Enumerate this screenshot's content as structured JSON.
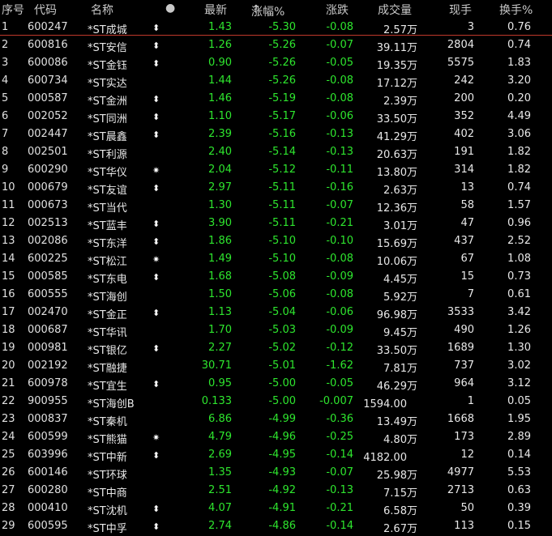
{
  "columns": {
    "no": "序号",
    "code": "代码",
    "name": "名称",
    "dot": "●",
    "last": "最新",
    "chgpct": "涨幅%",
    "sort_icon": "↑",
    "chg": "涨跌",
    "vol": "成交量",
    "hand": "现手",
    "turn": "换手%"
  },
  "unit_wan": "万",
  "rows": [
    {
      "no": "1",
      "code": "600247",
      "name": "*ST成城",
      "flag": "⬍",
      "last": "1.43",
      "chgpct": "-5.30",
      "chg": "-0.08",
      "vol": "2.57",
      "wan": true,
      "hand": "3",
      "turn": "0.76"
    },
    {
      "no": "2",
      "code": "600816",
      "name": "*ST安信",
      "flag": "⬍",
      "last": "1.26",
      "chgpct": "-5.26",
      "chg": "-0.07",
      "vol": "39.11",
      "wan": true,
      "hand": "2804",
      "turn": "0.74"
    },
    {
      "no": "3",
      "code": "600086",
      "name": "*ST金钰",
      "flag": "⬍",
      "last": "0.90",
      "chgpct": "-5.26",
      "chg": "-0.05",
      "vol": "19.35",
      "wan": true,
      "hand": "5575",
      "turn": "1.83"
    },
    {
      "no": "4",
      "code": "600734",
      "name": "*ST实达",
      "flag": "",
      "last": "1.44",
      "chgpct": "-5.26",
      "chg": "-0.08",
      "vol": "17.12",
      "wan": true,
      "hand": "242",
      "turn": "3.20"
    },
    {
      "no": "5",
      "code": "000587",
      "name": "*ST金洲",
      "flag": "⬍",
      "last": "1.46",
      "chgpct": "-5.19",
      "chg": "-0.08",
      "vol": "2.39",
      "wan": true,
      "hand": "200",
      "turn": "0.20"
    },
    {
      "no": "6",
      "code": "002052",
      "name": "*ST同洲",
      "flag": "⬍",
      "last": "1.10",
      "chgpct": "-5.17",
      "chg": "-0.06",
      "vol": "33.50",
      "wan": true,
      "hand": "352",
      "turn": "4.49"
    },
    {
      "no": "7",
      "code": "002447",
      "name": "*ST晨鑫",
      "flag": "⬍",
      "last": "2.39",
      "chgpct": "-5.16",
      "chg": "-0.13",
      "vol": "41.29",
      "wan": true,
      "hand": "402",
      "turn": "3.06"
    },
    {
      "no": "8",
      "code": "002501",
      "name": "*ST利源",
      "flag": "",
      "last": "2.40",
      "chgpct": "-5.14",
      "chg": "-0.13",
      "vol": "20.63",
      "wan": true,
      "hand": "191",
      "turn": "1.82"
    },
    {
      "no": "9",
      "code": "600290",
      "name": "*ST华仪",
      "flag": "✷",
      "last": "2.04",
      "chgpct": "-5.12",
      "chg": "-0.11",
      "vol": "13.80",
      "wan": true,
      "hand": "314",
      "turn": "1.82"
    },
    {
      "no": "10",
      "code": "000679",
      "name": "*ST友谊",
      "flag": "⬍",
      "last": "2.97",
      "chgpct": "-5.11",
      "chg": "-0.16",
      "vol": "2.63",
      "wan": true,
      "hand": "13",
      "turn": "0.74"
    },
    {
      "no": "11",
      "code": "000673",
      "name": "*ST当代",
      "flag": "",
      "last": "1.30",
      "chgpct": "-5.11",
      "chg": "-0.07",
      "vol": "12.36",
      "wan": true,
      "hand": "58",
      "turn": "1.57"
    },
    {
      "no": "12",
      "code": "002513",
      "name": "*ST蓝丰",
      "flag": "⬍",
      "last": "3.90",
      "chgpct": "-5.11",
      "chg": "-0.21",
      "vol": "3.01",
      "wan": true,
      "hand": "47",
      "turn": "0.96"
    },
    {
      "no": "13",
      "code": "002086",
      "name": "*ST东洋",
      "flag": "⬍",
      "last": "1.86",
      "chgpct": "-5.10",
      "chg": "-0.10",
      "vol": "15.69",
      "wan": true,
      "hand": "437",
      "turn": "2.52"
    },
    {
      "no": "14",
      "code": "600225",
      "name": "*ST松江",
      "flag": "✷",
      "last": "1.49",
      "chgpct": "-5.10",
      "chg": "-0.08",
      "vol": "10.06",
      "wan": true,
      "hand": "67",
      "turn": "1.08"
    },
    {
      "no": "15",
      "code": "000585",
      "name": "*ST东电",
      "flag": "⬍",
      "last": "1.68",
      "chgpct": "-5.08",
      "chg": "-0.09",
      "vol": "4.45",
      "wan": true,
      "hand": "15",
      "turn": "0.73"
    },
    {
      "no": "16",
      "code": "600555",
      "name": "*ST海创",
      "flag": "",
      "last": "1.50",
      "chgpct": "-5.06",
      "chg": "-0.08",
      "vol": "5.92",
      "wan": true,
      "hand": "7",
      "turn": "0.61"
    },
    {
      "no": "17",
      "code": "002470",
      "name": "*ST金正",
      "flag": "⬍",
      "last": "1.13",
      "chgpct": "-5.04",
      "chg": "-0.06",
      "vol": "96.98",
      "wan": true,
      "hand": "3533",
      "turn": "3.42"
    },
    {
      "no": "18",
      "code": "000687",
      "name": "*ST华讯",
      "flag": "",
      "last": "1.70",
      "chgpct": "-5.03",
      "chg": "-0.09",
      "vol": "9.45",
      "wan": true,
      "hand": "490",
      "turn": "1.26"
    },
    {
      "no": "19",
      "code": "000981",
      "name": "*ST银亿",
      "flag": "⬍",
      "last": "2.27",
      "chgpct": "-5.02",
      "chg": "-0.12",
      "vol": "33.50",
      "wan": true,
      "hand": "1689",
      "turn": "1.30"
    },
    {
      "no": "20",
      "code": "002192",
      "name": "*ST融捷",
      "flag": "",
      "last": "30.71",
      "chgpct": "-5.01",
      "chg": "-1.62",
      "vol": "7.81",
      "wan": true,
      "hand": "737",
      "turn": "3.02"
    },
    {
      "no": "21",
      "code": "600978",
      "name": "*ST宜生",
      "flag": "⬍",
      "last": "0.95",
      "chgpct": "-5.00",
      "chg": "-0.05",
      "vol": "46.29",
      "wan": true,
      "hand": "964",
      "turn": "3.12"
    },
    {
      "no": "22",
      "code": "900955",
      "name": "*ST海创B",
      "flag": "",
      "last": "0.133",
      "chgpct": "-5.00",
      "chg": "-0.007",
      "vol": "1594.00",
      "wan": false,
      "hand": "1",
      "turn": "0.05"
    },
    {
      "no": "23",
      "code": "000837",
      "name": "*ST秦机",
      "flag": "",
      "last": "6.86",
      "chgpct": "-4.99",
      "chg": "-0.36",
      "vol": "13.49",
      "wan": true,
      "hand": "1668",
      "turn": "1.95"
    },
    {
      "no": "24",
      "code": "600599",
      "name": "*ST熊猫",
      "flag": "✷",
      "last": "4.79",
      "chgpct": "-4.96",
      "chg": "-0.25",
      "vol": "4.80",
      "wan": true,
      "hand": "173",
      "turn": "2.89"
    },
    {
      "no": "25",
      "code": "603996",
      "name": "*ST中新",
      "flag": "⬍",
      "last": "2.69",
      "chgpct": "-4.95",
      "chg": "-0.14",
      "vol": "4182.00",
      "wan": false,
      "hand": "12",
      "turn": "0.14"
    },
    {
      "no": "26",
      "code": "600146",
      "name": "*ST环球",
      "flag": "",
      "last": "1.35",
      "chgpct": "-4.93",
      "chg": "-0.07",
      "vol": "25.98",
      "wan": true,
      "hand": "4977",
      "turn": "5.53"
    },
    {
      "no": "27",
      "code": "600280",
      "name": "*ST中商",
      "flag": "",
      "last": "2.51",
      "chgpct": "-4.92",
      "chg": "-0.13",
      "vol": "7.15",
      "wan": true,
      "hand": "2713",
      "turn": "0.63"
    },
    {
      "no": "28",
      "code": "000410",
      "name": "*ST沈机",
      "flag": "⬍",
      "last": "4.07",
      "chgpct": "-4.91",
      "chg": "-0.21",
      "vol": "6.58",
      "wan": true,
      "hand": "50",
      "turn": "0.39"
    },
    {
      "no": "29",
      "code": "600595",
      "name": "*ST中孚",
      "flag": "⬍",
      "last": "2.74",
      "chgpct": "-4.86",
      "chg": "-0.14",
      "vol": "2.67",
      "wan": true,
      "hand": "113",
      "turn": "0.15"
    }
  ]
}
